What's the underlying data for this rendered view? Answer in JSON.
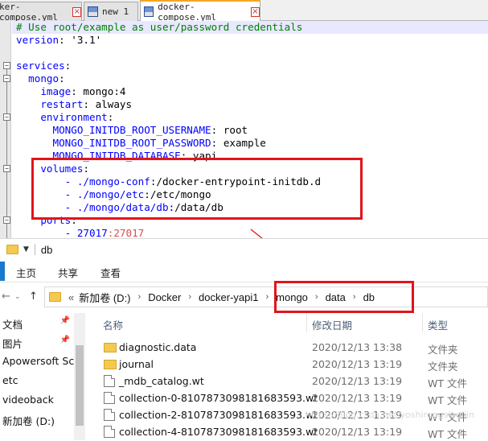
{
  "tabs": [
    {
      "label": "ker-compose.yml",
      "icon": "file-icon"
    },
    {
      "label": "new 1",
      "icon": "save-file-icon"
    },
    {
      "label": "docker-compose.yml",
      "icon": "save-file-icon",
      "active": true
    }
  ],
  "editor": {
    "lines": [
      {
        "t": "comment",
        "text": "# Use root/example as user/password credentials"
      },
      {
        "t": "kv",
        "key": "version",
        "sep": ": ",
        "val": "'3.1'"
      },
      {
        "t": "empty"
      },
      {
        "t": "kv",
        "key": "services",
        "sep": ":",
        "val": ""
      },
      {
        "t": "kv",
        "key": "  mongo",
        "sep": ":",
        "val": ""
      },
      {
        "t": "kv",
        "key": "    image",
        "sep": ": ",
        "val": "mongo:4"
      },
      {
        "t": "kv",
        "key": "    restart",
        "sep": ": ",
        "val": "always"
      },
      {
        "t": "kv",
        "key": "    environment",
        "sep": ":",
        "val": ""
      },
      {
        "t": "kv",
        "key": "      MONGO_INITDB_ROOT_USERNAME",
        "sep": ": ",
        "val": "root"
      },
      {
        "t": "kv",
        "key": "      MONGO_INITDB_ROOT_PASSWORD",
        "sep": ": ",
        "val": "example"
      },
      {
        "t": "kv",
        "key": "      MONGO_INITDB_DATABASE",
        "sep": ": ",
        "val": "yapi"
      },
      {
        "t": "kv",
        "key": "    volumes",
        "sep": ":",
        "val": ""
      },
      {
        "t": "vol",
        "a": "        - ./mongo-conf",
        "b": ":/docker-entrypoint-initdb.d"
      },
      {
        "t": "vol",
        "a": "        - ./mongo/etc",
        "b": ":/etc/mongo"
      },
      {
        "t": "vol",
        "a": "        - ./mongo/data/db",
        "b": ":/data/db"
      },
      {
        "t": "kv",
        "key": "    ports",
        "sep": ":",
        "val": ""
      },
      {
        "t": "port",
        "a": "        - 27017",
        "b": ":27017"
      }
    ]
  },
  "explorer": {
    "title": "db",
    "ribbon": {
      "home": "主页",
      "share": "共享",
      "view": "查看"
    },
    "breadcrumb": [
      "«",
      "新加卷 (D:)",
      "Docker",
      "docker-yapi1",
      "mongo",
      "data",
      "db"
    ],
    "columns": {
      "name": "名称",
      "date": "修改日期",
      "type": "类型"
    },
    "nav": [
      "文档",
      "图片",
      "Apowersoft Scr",
      "etc",
      "videoback",
      "新加卷 (D:)"
    ],
    "files": [
      {
        "name": "diagnostic.data",
        "date": "2020/12/13 13:38",
        "type": "文件夹",
        "kind": "folder"
      },
      {
        "name": "journal",
        "date": "2020/12/13 13:19",
        "type": "文件夹",
        "kind": "folder"
      },
      {
        "name": "_mdb_catalog.wt",
        "date": "2020/12/13 13:19",
        "type": "WT 文件",
        "kind": "doc"
      },
      {
        "name": "collection-0-8107873098181683593.wt",
        "date": "2020/12/13 13:19",
        "type": "WT 文件",
        "kind": "doc"
      },
      {
        "name": "collection-2-8107873098181683593.wt",
        "date": "2020/12/13 13:19",
        "type": "WT 文件",
        "kind": "doc"
      },
      {
        "name": "collection-4-8107873098181683593.wt",
        "date": "2020/12/13 13:19",
        "type": "WT 文件",
        "kind": "doc"
      }
    ],
    "watermark": "https://blog.csdn.net/yoshiroggsiaoliin"
  },
  "colors": {
    "annotation": "#e1141b",
    "yaml_key": "#0000ff",
    "comment": "#008000"
  }
}
